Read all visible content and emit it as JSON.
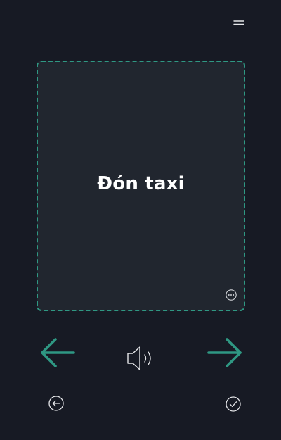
{
  "card": {
    "word": "Đón taxi"
  },
  "colors": {
    "background": "#171a24",
    "card": "#21262f",
    "accent": "#2f9883",
    "icon": "#e6e7ea"
  },
  "icons": {
    "menu": "hamburger-menu-icon",
    "more": "more-options-icon",
    "prev": "arrow-left-icon",
    "next": "arrow-right-icon",
    "speaker": "speaker-icon",
    "back": "circle-back-icon",
    "done": "circle-check-icon"
  }
}
